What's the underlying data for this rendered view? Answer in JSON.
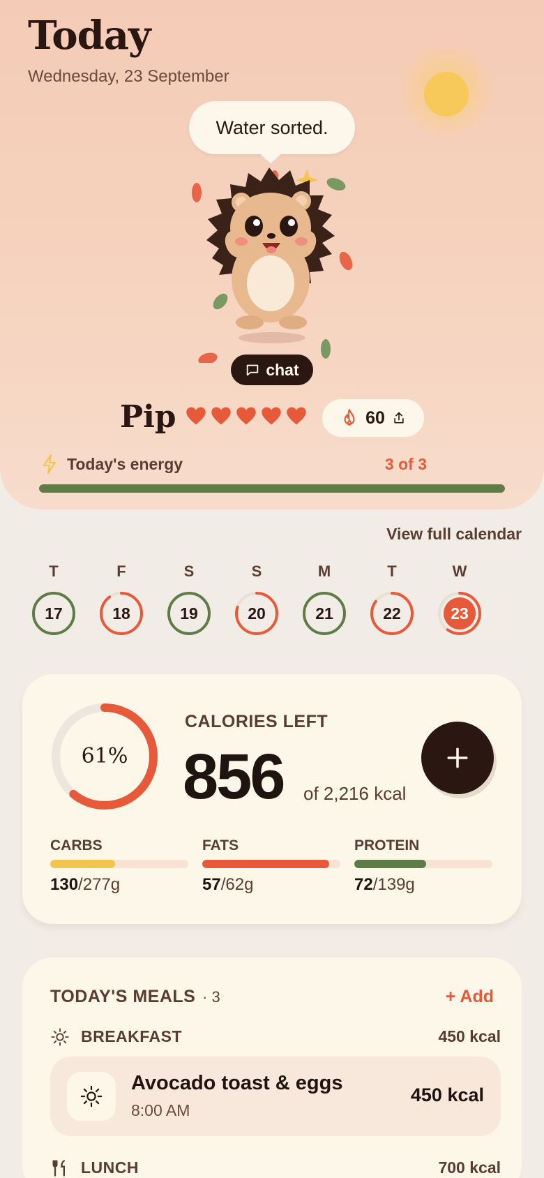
{
  "header": {
    "title": "Today",
    "date": "Wednesday, 23 September"
  },
  "companion": {
    "speech": "Water sorted.",
    "chat_label": "chat",
    "name": "Pip",
    "hearts_filled": 5,
    "hearts_total": 5,
    "streak_value": "60"
  },
  "energy": {
    "label": "Today's energy",
    "count_text": "3 of 3",
    "fraction": 1.0
  },
  "calendar": {
    "view_link": "View full calendar",
    "days": [
      {
        "letter": "T",
        "num": "17",
        "status": "complete",
        "progress": 1.0
      },
      {
        "letter": "F",
        "num": "18",
        "status": "over",
        "progress": 0.9
      },
      {
        "letter": "S",
        "num": "19",
        "status": "complete",
        "progress": 1.0
      },
      {
        "letter": "S",
        "num": "20",
        "status": "over",
        "progress": 0.8
      },
      {
        "letter": "M",
        "num": "21",
        "status": "complete",
        "progress": 1.0
      },
      {
        "letter": "T",
        "num": "22",
        "status": "over",
        "progress": 0.85
      },
      {
        "letter": "W",
        "num": "23",
        "status": "today",
        "progress": 0.6
      }
    ]
  },
  "calories": {
    "label": "CALORIES LEFT",
    "percent_text": "61%",
    "percent": 0.61,
    "left": "856",
    "of_text": "of 2,216 kcal",
    "macros": [
      {
        "label": "CARBS",
        "current": "130",
        "goal": "/277g",
        "fraction": 0.47,
        "color": "#f4c54d"
      },
      {
        "label": "FATS",
        "current": "57",
        "goal": "/62g",
        "fraction": 0.92,
        "color": "#e65a3a"
      },
      {
        "label": "PROTEIN",
        "current": "72",
        "goal": "/139g",
        "fraction": 0.52,
        "color": "#5f7c46"
      }
    ]
  },
  "meals": {
    "title": "TODAY'S MEALS",
    "count_text": "· 3",
    "add_label": "+ Add",
    "breakfast": {
      "label": "BREAKFAST",
      "kcal": "450 kcal",
      "item": {
        "name": "Avocado toast & eggs",
        "time": "8:00 AM",
        "kcal": "450 kcal"
      }
    },
    "lunch": {
      "label": "LUNCH",
      "kcal": "700 kcal"
    }
  },
  "colors": {
    "accent": "#e65a3a",
    "green": "#5f7c46",
    "dark": "#2a1711",
    "yellow": "#f4c54d"
  }
}
